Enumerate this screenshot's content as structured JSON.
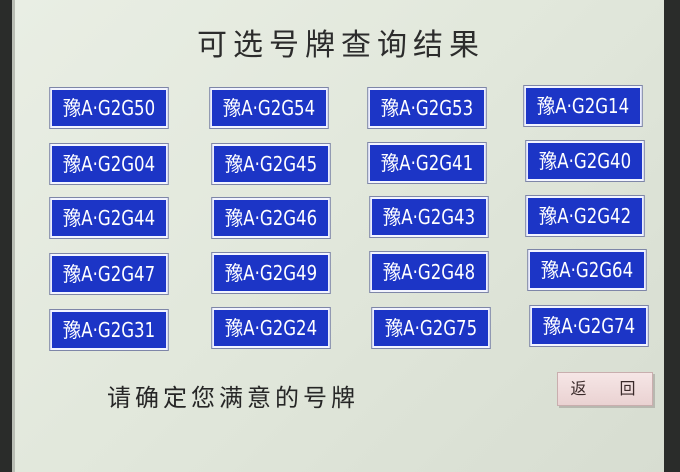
{
  "title": "可选号牌查询结果",
  "plates": [
    "豫A·G2G50",
    "豫A·G2G54",
    "豫A·G2G53",
    "豫A·G2G14",
    "豫A·G2G04",
    "豫A·G2G45",
    "豫A·G2G41",
    "豫A·G2G40",
    "豫A·G2G44",
    "豫A·G2G46",
    "豫A·G2G43",
    "豫A·G2G42",
    "豫A·G2G47",
    "豫A·G2G49",
    "豫A·G2G48",
    "豫A·G2G64",
    "豫A·G2G31",
    "豫A·G2G24",
    "豫A·G2G75",
    "豫A·G2G74"
  ],
  "prompt": "请确定您满意的号牌",
  "back_label": "返 回",
  "colors": {
    "plate_blue": "#1c35c6",
    "background": "#e5ebdf"
  }
}
